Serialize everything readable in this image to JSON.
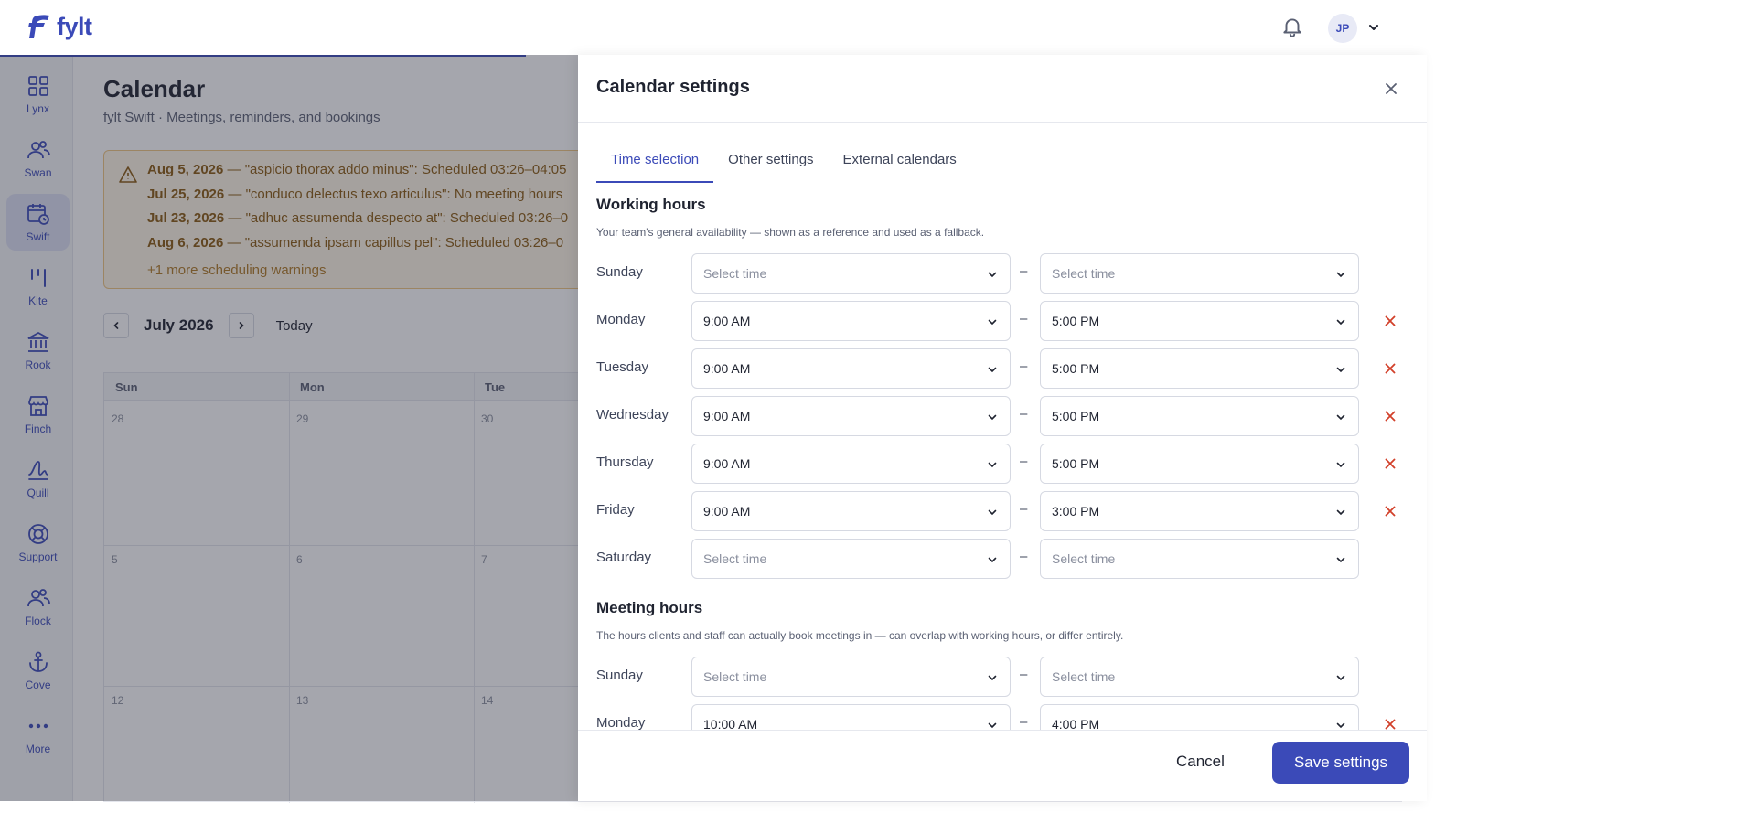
{
  "app": {
    "logo_text": "fylt",
    "avatar_initials": "JP",
    "brand_color": "#3b4ab8"
  },
  "sidebar": {
    "items": [
      {
        "label": "Lynx",
        "icon": "grid-icon"
      },
      {
        "label": "Swan",
        "icon": "people-icon"
      },
      {
        "label": "Swift",
        "icon": "calendar-clock-icon",
        "active": true
      },
      {
        "label": "Kite",
        "icon": "kite-bars-icon"
      },
      {
        "label": "Rook",
        "icon": "bank-icon"
      },
      {
        "label": "Finch",
        "icon": "store-icon"
      },
      {
        "label": "Quill",
        "icon": "signature-icon"
      },
      {
        "label": "Support",
        "icon": "lifebuoy-icon"
      },
      {
        "label": "Flock",
        "icon": "group-icon"
      },
      {
        "label": "Cove",
        "icon": "anchor-icon"
      },
      {
        "label": "More",
        "icon": "more-dots-icon"
      }
    ]
  },
  "page": {
    "title": "Calendar",
    "subtitle": "fylt Swift · Meetings, reminders, and bookings",
    "warnings": [
      {
        "date": "Aug 5, 2026",
        "text": " — \"aspicio thorax addo minus\": Scheduled 03:26–04:05"
      },
      {
        "date": "Jul 25, 2026",
        "text": " — \"conduco delectus texo articulus\": No meeting hours"
      },
      {
        "date": "Jul 23, 2026",
        "text": " — \"adhuc assumenda despecto at\": Scheduled 03:26–0"
      },
      {
        "date": "Aug 6, 2026",
        "text": " — \"assumenda ipsam capillus pel\": Scheduled 03:26–0"
      }
    ],
    "warnings_more": "+1 more scheduling warnings",
    "month": "July 2026",
    "today_label": "Today",
    "weekdays": [
      "Sun",
      "Mon",
      "Tue"
    ],
    "day_numbers": [
      "28",
      "29",
      "30",
      "5",
      "6",
      "7",
      "12",
      "13",
      "14"
    ]
  },
  "drawer": {
    "title": "Calendar settings",
    "tabs": [
      "Time selection",
      "Other settings",
      "External calendars"
    ],
    "working": {
      "title": "Working hours",
      "desc": "Your team's general availability — shown as a reference and used as a fallback.",
      "rows": [
        {
          "day": "Sunday",
          "start": "Select time",
          "end": "Select time"
        },
        {
          "day": "Monday",
          "start": "9:00 AM",
          "end": "5:00 PM"
        },
        {
          "day": "Tuesday",
          "start": "9:00 AM",
          "end": "5:00 PM"
        },
        {
          "day": "Wednesday",
          "start": "9:00 AM",
          "end": "5:00 PM"
        },
        {
          "day": "Thursday",
          "start": "9:00 AM",
          "end": "5:00 PM"
        },
        {
          "day": "Friday",
          "start": "9:00 AM",
          "end": "3:00 PM"
        },
        {
          "day": "Saturday",
          "start": "Select time",
          "end": "Select time"
        }
      ]
    },
    "meeting": {
      "title": "Meeting hours",
      "desc": "The hours clients and staff can actually book meetings in — can overlap with working hours, or differ entirely.",
      "rows": [
        {
          "day": "Sunday",
          "start": "Select time",
          "end": "Select time"
        },
        {
          "day": "Monday",
          "start": "10:00 AM",
          "end": "4:00 PM"
        }
      ]
    },
    "dash": "–",
    "cancel_label": "Cancel",
    "save_label": "Save settings"
  }
}
